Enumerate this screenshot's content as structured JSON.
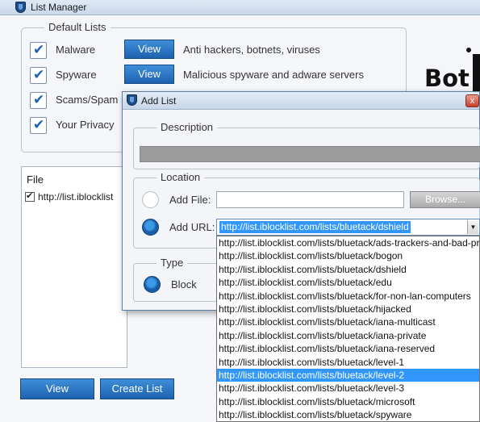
{
  "window": {
    "title": "List Manager"
  },
  "default_lists": {
    "legend": "Default Lists",
    "items": [
      {
        "label": "Malware",
        "checked": true,
        "button": "View",
        "description": "Anti hackers, botnets, viruses"
      },
      {
        "label": "Spyware",
        "checked": true,
        "button": "View",
        "description": "Malicious spyware and adware servers"
      },
      {
        "label": "Scams/Spam",
        "checked": true
      },
      {
        "label": "Your Privacy",
        "checked": true
      }
    ]
  },
  "logo": {
    "text": "Bot"
  },
  "file_list": {
    "header": "File",
    "rows": [
      {
        "text": "http://list.iblocklist",
        "checked": true
      }
    ]
  },
  "bottom_buttons": {
    "view": "View",
    "create_list": "Create List"
  },
  "dialog": {
    "title": "Add List",
    "close": "x",
    "description_legend": "Description",
    "location_legend": "Location",
    "add_file_label": "Add File:",
    "browse_button": "Browse...",
    "add_url_label": "Add URL:",
    "url_value": "http://list.iblocklist.com/lists/bluetack/dshield",
    "type_legend": "Type",
    "block_label": "Block"
  },
  "url_dropdown": {
    "selected_index": 12,
    "options": [
      "http://list.iblocklist.com/lists/bluetack/ads-trackers-and-bad-pr",
      "http://list.iblocklist.com/lists/bluetack/bogon",
      "http://list.iblocklist.com/lists/bluetack/dshield",
      "http://list.iblocklist.com/lists/bluetack/edu",
      "http://list.iblocklist.com/lists/bluetack/for-non-lan-computers",
      "http://list.iblocklist.com/lists/bluetack/hijacked",
      "http://list.iblocklist.com/lists/bluetack/iana-multicast",
      "http://list.iblocklist.com/lists/bluetack/iana-private",
      "http://list.iblocklist.com/lists/bluetack/iana-reserved",
      "http://list.iblocklist.com/lists/bluetack/level-1",
      "http://list.iblocklist.com/lists/bluetack/level-2",
      "http://list.iblocklist.com/lists/bluetack/level-3",
      "http://list.iblocklist.com/lists/bluetack/microsoft",
      "http://list.iblocklist.com/lists/bluetack/spyware"
    ]
  }
}
